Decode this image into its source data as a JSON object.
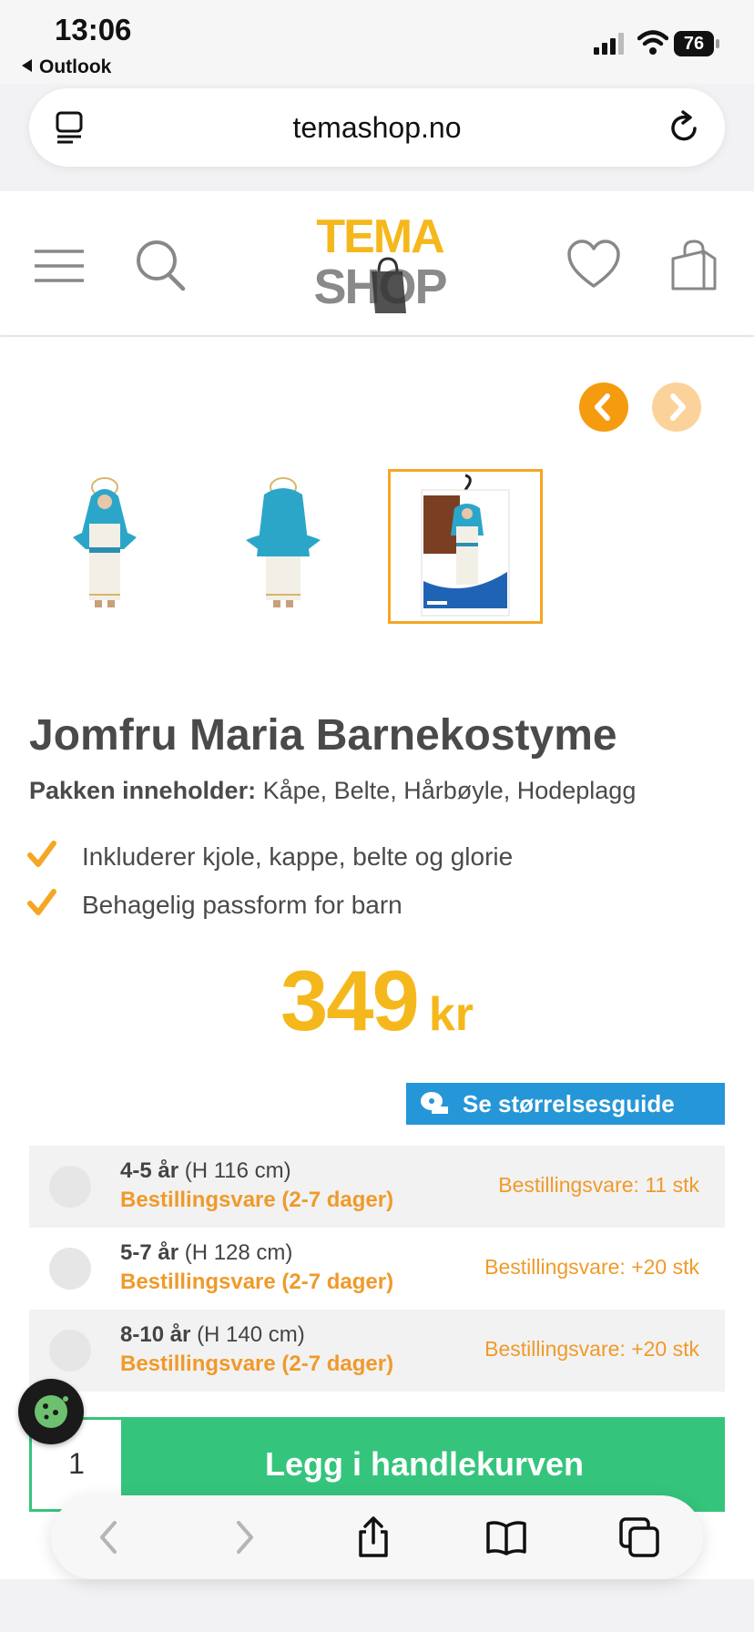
{
  "status": {
    "time": "13:06",
    "back_app": "Outlook",
    "battery": "76"
  },
  "browser": {
    "url": "temashop.no"
  },
  "site": {
    "logo_top": "TEMA",
    "logo_bottom": "SHOP"
  },
  "product": {
    "title": "Jomfru Maria Barnekostyme",
    "package_label": "Pakken inneholder:",
    "package_items": "Kåpe, Belte, Hårbøyle, Hodeplagg",
    "features": [
      "Inkluderer kjole, kappe, belte og glorie",
      "Behagelig passform for barn"
    ],
    "price": "349",
    "currency": "kr"
  },
  "size_guide": {
    "label": "Se størrelsesguide"
  },
  "sizes": [
    {
      "age": "4-5 år",
      "height": "(H 116 cm)",
      "availability": "Bestillingsvare (2-7 dager)",
      "stock": "Bestillingsvare: 11 stk"
    },
    {
      "age": "5-7 år",
      "height": "(H 128 cm)",
      "availability": "Bestillingsvare (2-7 dager)",
      "stock": "Bestillingsvare: +20 stk"
    },
    {
      "age": "8-10 år",
      "height": "(H 140 cm)",
      "availability": "Bestillingsvare (2-7 dager)",
      "stock": "Bestillingsvare: +20 stk"
    }
  ],
  "cart": {
    "quantity": "1",
    "add_label": "Legg i handlekurven"
  },
  "colors": {
    "accent_orange": "#f5b81c",
    "cart_green": "#35c47c",
    "guide_blue": "#2596d8"
  }
}
